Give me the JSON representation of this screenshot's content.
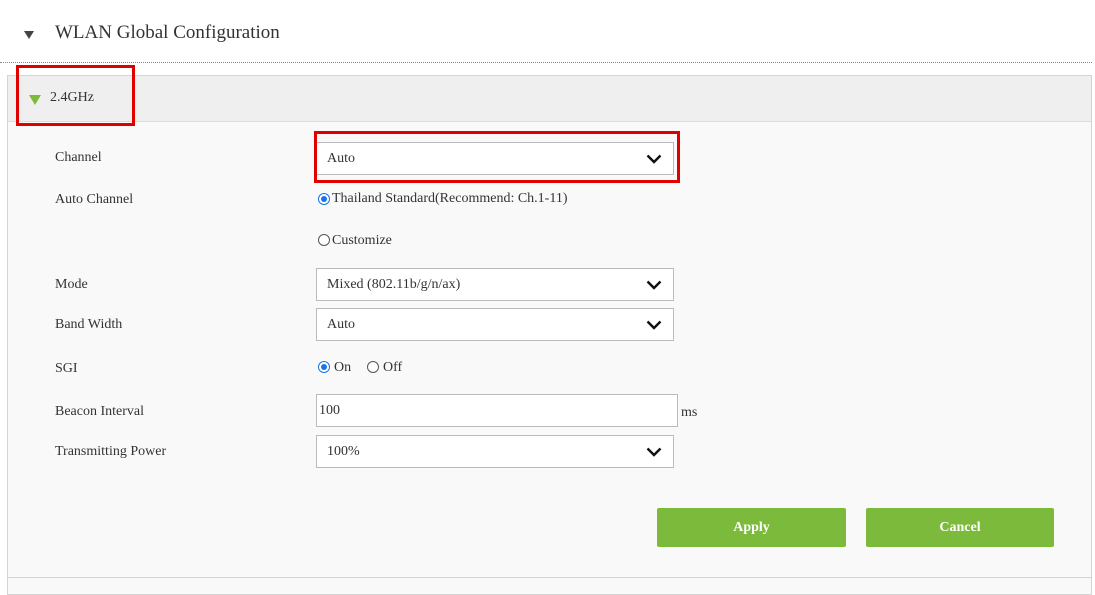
{
  "section": {
    "title": "WLAN Global Configuration"
  },
  "band": {
    "title": "2.4GHz"
  },
  "fields": {
    "channel": {
      "label": "Channel",
      "value": "Auto"
    },
    "auto_channel": {
      "label": "Auto Channel",
      "options": [
        "Thailand Standard(Recommend: Ch.1-11)",
        "Customize"
      ],
      "selected": "Thailand Standard(Recommend: Ch.1-11)"
    },
    "mode": {
      "label": "Mode",
      "value": "Mixed (802.11b/g/n/ax)"
    },
    "band_width": {
      "label": "Band Width",
      "value": "Auto"
    },
    "sgi": {
      "label": "SGI",
      "options": [
        "On",
        "Off"
      ],
      "selected": "On"
    },
    "beacon_interval": {
      "label": "Beacon Interval",
      "value": "100",
      "unit": "ms"
    },
    "transmitting_power": {
      "label": "Transmitting Power",
      "value": "100%"
    }
  },
  "buttons": {
    "apply": "Apply",
    "cancel": "Cancel"
  },
  "colors": {
    "accent": "#7cba3c",
    "highlight": "#e00000",
    "radio": "#1a73e8"
  },
  "icons": {
    "collapse": "triangle-down-icon",
    "dropdown": "chevron-down-icon"
  }
}
